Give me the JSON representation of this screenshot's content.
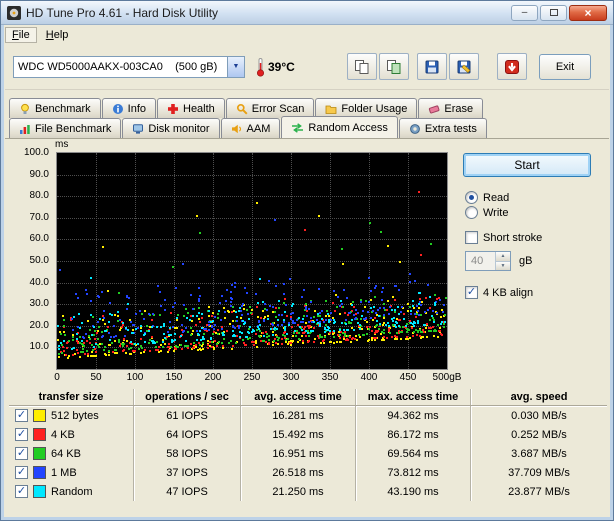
{
  "window": {
    "title": "HD Tune Pro 4.61 - Hard Disk Utility"
  },
  "menu": {
    "items": [
      {
        "label": "File"
      },
      {
        "label": "Help"
      }
    ]
  },
  "toolbar": {
    "drive_select": "WDC WD5000AAKX-003CA0    (500 gB)",
    "temperature": "39°C",
    "exit_label": "Exit"
  },
  "tabs": {
    "row1": [
      {
        "label": "Benchmark"
      },
      {
        "label": "Info"
      },
      {
        "label": "Health"
      },
      {
        "label": "Error Scan"
      },
      {
        "label": "Folder Usage"
      },
      {
        "label": "Erase"
      }
    ],
    "row2": [
      {
        "label": "File Benchmark"
      },
      {
        "label": "Disk monitor"
      },
      {
        "label": "AAM"
      },
      {
        "label": "Random Access",
        "active": true
      },
      {
        "label": "Extra tests"
      }
    ]
  },
  "controls": {
    "start_label": "Start",
    "read_label": "Read",
    "write_label": "Write",
    "read_selected": true,
    "short_stroke_label": "Short stroke",
    "short_stroke_checked": false,
    "short_stroke_value": "40",
    "short_stroke_unit": "gB",
    "align_label": "4 KB align",
    "align_checked": true
  },
  "chart_data": {
    "type": "scatter",
    "title": "Random Access time vs disk position",
    "ylabel": "ms",
    "xlim": [
      0,
      500
    ],
    "ylim": [
      0,
      100
    ],
    "grid": true,
    "yticks": [
      {
        "label": "100.0",
        "value": 100
      },
      {
        "label": "90.0",
        "value": 90
      },
      {
        "label": "80.0",
        "value": 80
      },
      {
        "label": "70.0",
        "value": 70
      },
      {
        "label": "60.0",
        "value": 60
      },
      {
        "label": "50.0",
        "value": 50
      },
      {
        "label": "40.0",
        "value": 40
      },
      {
        "label": "30.0",
        "value": 30
      },
      {
        "label": "20.0",
        "value": 20
      },
      {
        "label": "10.0",
        "value": 10
      }
    ],
    "xticks": [
      {
        "label": "0",
        "value": 0
      },
      {
        "label": "50",
        "value": 50
      },
      {
        "label": "100",
        "value": 100
      },
      {
        "label": "150",
        "value": 150
      },
      {
        "label": "200",
        "value": 200
      },
      {
        "label": "250",
        "value": 250
      },
      {
        "label": "300",
        "value": 300
      },
      {
        "label": "350",
        "value": 350
      },
      {
        "label": "400",
        "value": 400
      },
      {
        "label": "450",
        "value": 450
      },
      {
        "label": "500gB",
        "value": 500
      }
    ],
    "series": [
      {
        "name": "512 bytes",
        "color": "#ffee00",
        "avg_ms": 16.281,
        "max_ms": 94.362,
        "base_ms": 5,
        "slope_ms": 10,
        "spread_ms": 20,
        "points": 280,
        "outlier_rate": 0.035
      },
      {
        "name": "4 KB",
        "color": "#ff2020",
        "avg_ms": 15.492,
        "max_ms": 86.172,
        "base_ms": 6,
        "slope_ms": 10,
        "spread_ms": 18,
        "points": 250,
        "outlier_rate": 0.03
      },
      {
        "name": "64 KB",
        "color": "#22cc22",
        "avg_ms": 16.951,
        "max_ms": 69.564,
        "base_ms": 7,
        "slope_ms": 11,
        "spread_ms": 18,
        "points": 250,
        "outlier_rate": 0.03
      },
      {
        "name": "1 MB",
        "color": "#2244ff",
        "avg_ms": 26.518,
        "max_ms": 73.812,
        "base_ms": 13,
        "slope_ms": 13,
        "spread_ms": 22,
        "points": 230,
        "outlier_rate": 0.04
      },
      {
        "name": "Random",
        "color": "#00e8ff",
        "avg_ms": 21.25,
        "max_ms": 43.19,
        "base_ms": 9,
        "slope_ms": 12,
        "spread_ms": 16,
        "points": 230,
        "outlier_rate": 0.02
      }
    ]
  },
  "table": {
    "headers": [
      "transfer size",
      "operations / sec",
      "avg. access time",
      "max. access time",
      "avg. speed"
    ],
    "rows": [
      {
        "color": "#ffee00",
        "label": "512 bytes",
        "iops": "61 IOPS",
        "avg": "16.281 ms",
        "max": "94.362 ms",
        "speed": "0.030 MB/s",
        "checked": true
      },
      {
        "color": "#ff2020",
        "label": "4 KB",
        "iops": "64 IOPS",
        "avg": "15.492 ms",
        "max": "86.172 ms",
        "speed": "0.252 MB/s",
        "checked": true
      },
      {
        "color": "#22cc22",
        "label": "64 KB",
        "iops": "58 IOPS",
        "avg": "16.951 ms",
        "max": "69.564 ms",
        "speed": "3.687 MB/s",
        "checked": true
      },
      {
        "color": "#2244ff",
        "label": "1 MB",
        "iops": "37 IOPS",
        "avg": "26.518 ms",
        "max": "73.812 ms",
        "speed": "37.709 MB/s",
        "checked": true
      },
      {
        "color": "#00e8ff",
        "label": "Random",
        "iops": "47 IOPS",
        "avg": "21.250 ms",
        "max": "43.190 ms",
        "speed": "23.877 MB/s",
        "checked": true
      }
    ]
  }
}
